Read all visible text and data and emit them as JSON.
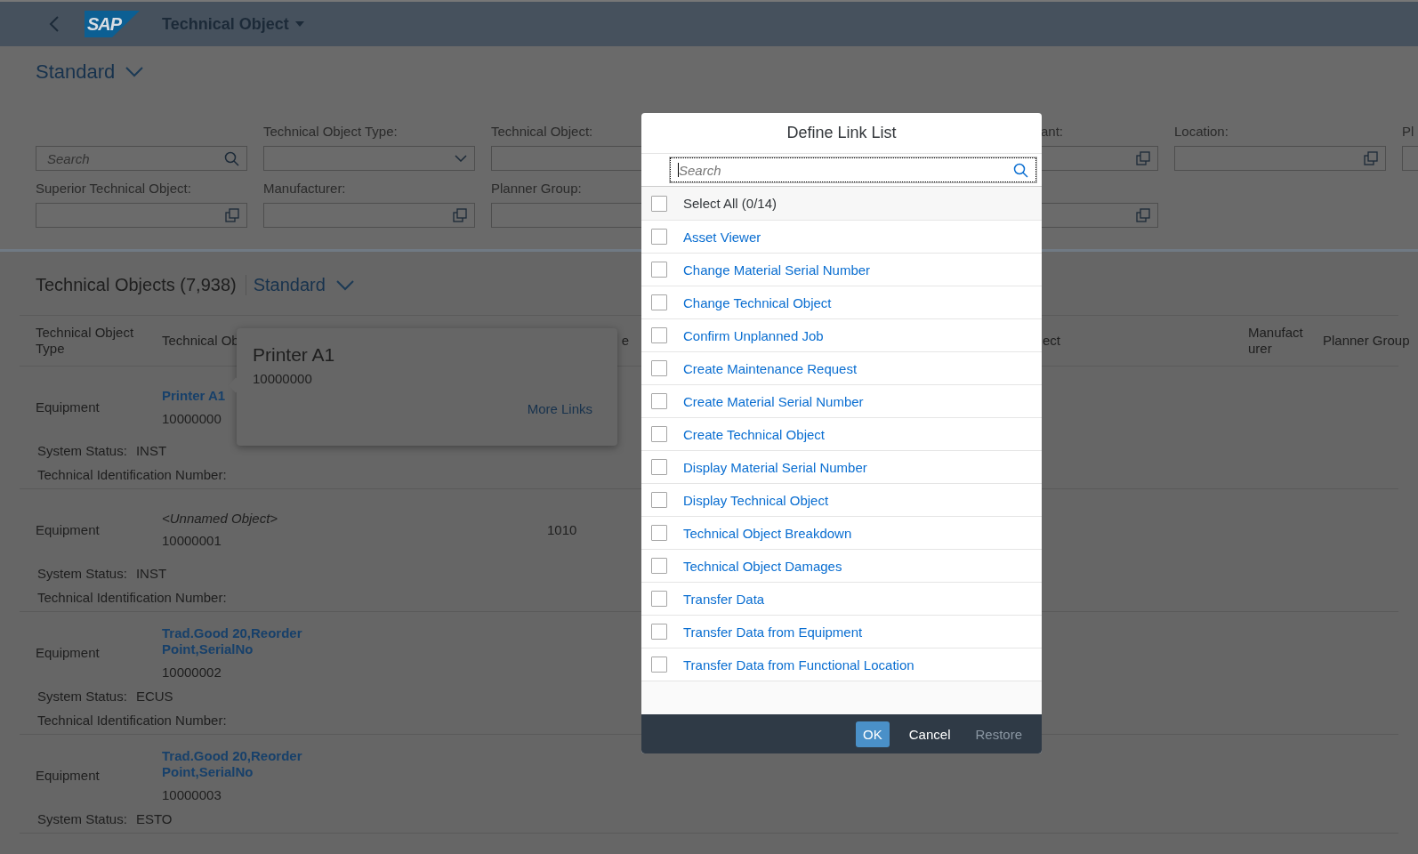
{
  "shell": {
    "logo": "SAP",
    "title": "Technical Object"
  },
  "variant": {
    "label": "Standard"
  },
  "filters": [
    [
      {
        "kind": "search",
        "placeholder": "Search"
      },
      {
        "kind": "select",
        "label": "Technical Object Type:"
      },
      {
        "kind": "edge",
        "label": "Technical Object:"
      },
      {
        "kind": "covered"
      },
      {
        "kind": "cut",
        "label": "ant:"
      },
      {
        "kind": "valuehelp",
        "label": "Location:"
      },
      {
        "kind": "edge",
        "label": "Pl"
      }
    ],
    [
      {
        "kind": "valuehelp",
        "label": "Superior Technical Object:"
      },
      {
        "kind": "valuehelp",
        "label": "Manufacturer:"
      },
      {
        "kind": "edge",
        "label": "Planner Group:"
      },
      {
        "kind": "covered"
      },
      {
        "kind": "valuehelp"
      }
    ]
  ],
  "table": {
    "title": "Technical Objects (7,938)",
    "variant": "Standard",
    "columns": [
      "Technical Object Type",
      "Technical Ob",
      "e",
      "ect",
      "Manufact urer",
      "Planner Group"
    ],
    "rows": [
      {
        "type": "Equipment",
        "name": "Printer A1",
        "kind": "link",
        "number": "10000000",
        "status_label": "System Status:",
        "status": "INST",
        "tech_id_label": "Technical Identification Number:"
      },
      {
        "type": "Equipment",
        "name": "<Unnamed Object>",
        "kind": "unnamed",
        "number": "10000001",
        "value": "1010",
        "status_label": "System Status:",
        "status": "INST",
        "tech_id_label": "Technical Identification Number:"
      },
      {
        "type": "Equipment",
        "name": "Trad.Good 20,Reorder Point,SerialNo",
        "kind": "link",
        "number": "10000002",
        "status_label": "System Status:",
        "status": "ECUS",
        "tech_id_label": "Technical Identification Number:"
      },
      {
        "type": "Equipment",
        "name": "Trad.Good 20,Reorder Point,SerialNo",
        "kind": "link",
        "number": "10000003",
        "status_label": "System Status:",
        "status": "ESTO"
      }
    ]
  },
  "popover": {
    "title": "Printer A1",
    "number": "10000000",
    "link": "More Links"
  },
  "dialog": {
    "title": "Define Link List",
    "search_placeholder": "Search",
    "select_all": {
      "label": "Select All (0/14)",
      "checked": false
    },
    "items": [
      {
        "label": "Asset Viewer",
        "checked": false
      },
      {
        "label": "Change Material Serial Number",
        "checked": false
      },
      {
        "label": "Change Technical Object",
        "checked": false
      },
      {
        "label": "Confirm Unplanned Job",
        "checked": false
      },
      {
        "label": "Create Maintenance Request",
        "checked": false
      },
      {
        "label": "Create Material Serial Number",
        "checked": false
      },
      {
        "label": "Create Technical Object",
        "checked": false
      },
      {
        "label": "Display Material Serial Number",
        "checked": false
      },
      {
        "label": "Display Technical Object",
        "checked": false
      },
      {
        "label": "Technical Object Breakdown",
        "checked": false
      },
      {
        "label": "Technical Object Damages",
        "checked": false
      },
      {
        "label": "Transfer Data",
        "checked": false
      },
      {
        "label": "Transfer Data from Equipment",
        "checked": false
      },
      {
        "label": "Transfer Data from Functional Location",
        "checked": false
      }
    ],
    "buttons": [
      {
        "label": "OK",
        "kind": "emphasized",
        "disabled": false
      },
      {
        "label": "Cancel",
        "kind": "plain",
        "disabled": false
      },
      {
        "label": "Restore",
        "kind": "plain",
        "disabled": true
      }
    ]
  }
}
